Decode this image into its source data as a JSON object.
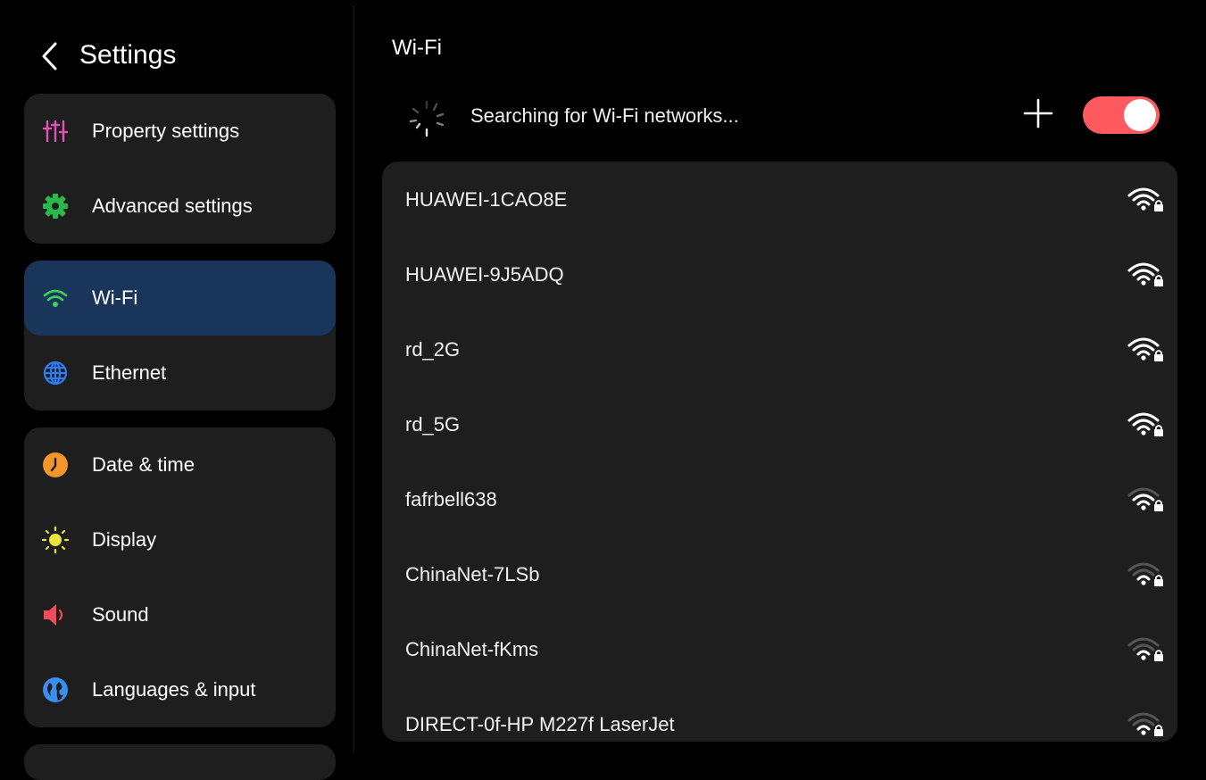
{
  "sidebar": {
    "title": "Settings",
    "groups": [
      {
        "items": [
          {
            "label": "Property settings",
            "icon": "sliders-icon",
            "color": "#e052b3"
          },
          {
            "label": "Advanced settings",
            "icon": "gear-icon",
            "color": "#2bb84b"
          }
        ]
      },
      {
        "items": [
          {
            "label": "Wi-Fi",
            "icon": "wifi-icon",
            "color": "#3ecf5a",
            "selected": true
          },
          {
            "label": "Ethernet",
            "icon": "globe-icon",
            "color": "#2f7df1"
          }
        ]
      },
      {
        "items": [
          {
            "label": "Date & time",
            "icon": "clock-icon",
            "color": "#f2952b"
          },
          {
            "label": "Display",
            "icon": "sun-icon",
            "color": "#e9e63a"
          },
          {
            "label": "Sound",
            "icon": "speaker-icon",
            "color": "#f04b5a"
          },
          {
            "label": "Languages & input",
            "icon": "earth-icon",
            "color": "#3a8ef0"
          }
        ]
      }
    ]
  },
  "main": {
    "title": "Wi-Fi",
    "search_status": "Searching for Wi-Fi networks...",
    "toggle_on": true,
    "accent": "#ff5a5f",
    "networks": [
      {
        "name": "HUAWEI-1CAO8E",
        "signal": 4,
        "secured": true
      },
      {
        "name": "HUAWEI-9J5ADQ",
        "signal": 4,
        "secured": true
      },
      {
        "name": "rd_2G",
        "signal": 4,
        "secured": true
      },
      {
        "name": "rd_5G",
        "signal": 4,
        "secured": true
      },
      {
        "name": "fafrbell638",
        "signal": 3,
        "secured": true
      },
      {
        "name": "ChinaNet-7LSb",
        "signal": 2,
        "secured": true
      },
      {
        "name": "ChinaNet-fKms",
        "signal": 2,
        "secured": true
      },
      {
        "name": "DIRECT-0f-HP M227f LaserJet",
        "signal": 2,
        "secured": true
      }
    ]
  }
}
